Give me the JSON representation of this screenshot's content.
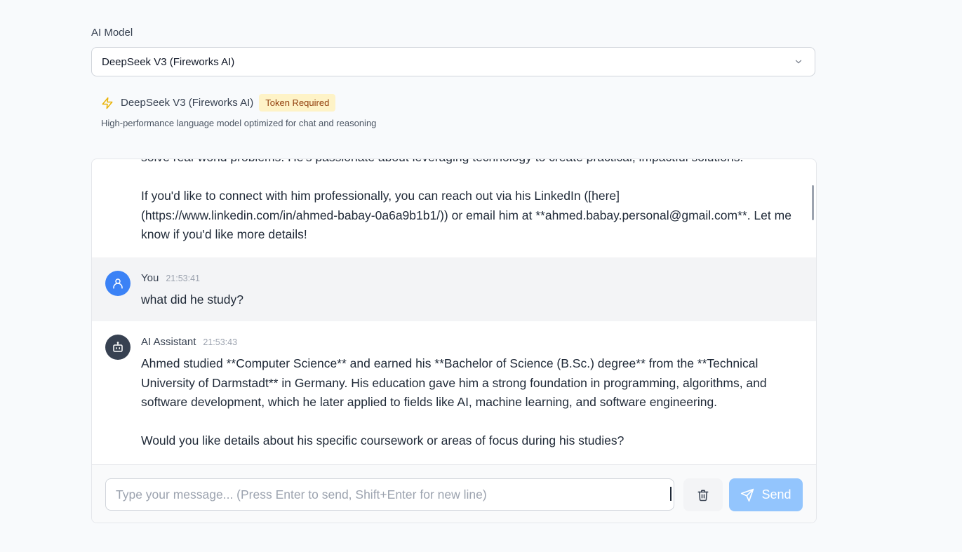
{
  "model_selector": {
    "label": "AI Model",
    "selected": "DeepSeek V3 (Fireworks AI)",
    "icon": "chevron-down-icon"
  },
  "model_info": {
    "icon": "lightning-icon",
    "name": "DeepSeek V3 (Fireworks AI)",
    "badge": "Token Required",
    "description": "High-performance language model optimized for chat and reasoning"
  },
  "messages": [
    {
      "role": "assistant",
      "text": "solve real-world problems. He's passionate about leveraging technology to create practical, impactful solutions.\n\nIf you'd like to connect with him professionally, you can reach out via his LinkedIn ([here](https://www.linkedin.com/in/ahmed-babay-0a6a9b1b1/)) or email him at **ahmed.babay.personal@gmail.com**. Let me know if you'd like more details!"
    },
    {
      "role": "user",
      "author": "You",
      "time": "21:53:41",
      "text": "what did he study?",
      "icon": "user-icon"
    },
    {
      "role": "assistant",
      "author": "AI Assistant",
      "time": "21:53:43",
      "text": "Ahmed studied **Computer Science** and earned his **Bachelor of Science (B.Sc.) degree** from the **Technical University of Darmstadt** in Germany. His education gave him a strong foundation in programming, algorithms, and software development, which he later applied to fields like AI, machine learning, and software engineering.\n\nWould you like details about his specific coursework or areas of focus during his studies?",
      "icon": "bot-icon"
    }
  ],
  "composer": {
    "placeholder": "Type your message... (Press Enter to send, Shift+Enter for new line)",
    "value": "",
    "clear_icon": "trash-icon",
    "send_label": "Send",
    "send_icon": "send-icon"
  },
  "colors": {
    "user_avatar": "#3b82f6",
    "ai_avatar": "#374151",
    "badge_bg": "#fef3c7",
    "send_button": "#93c5fd"
  }
}
